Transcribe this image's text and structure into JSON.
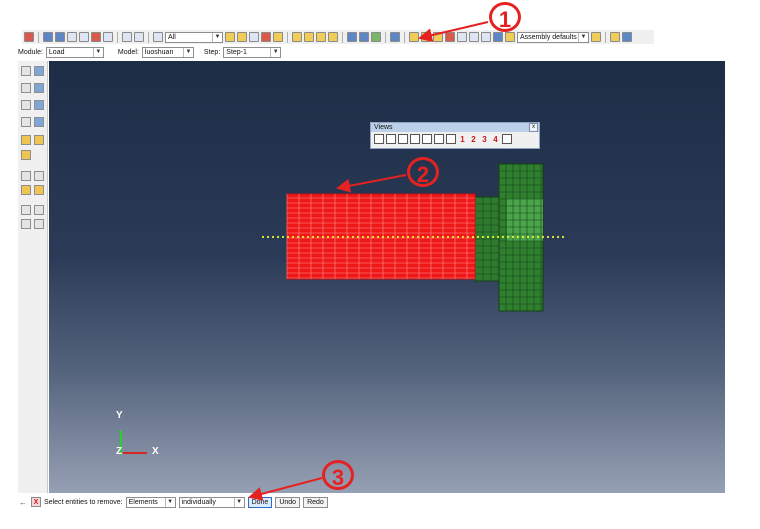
{
  "toolbar": {
    "select_filter": "All",
    "assembly_display": "Assembly defaults"
  },
  "context": {
    "module_label": "Module:",
    "module_value": "Load",
    "model_label": "Model:",
    "model_value": "luoshuan",
    "step_label": "Step:",
    "step_value": "Step-1"
  },
  "views": {
    "title": "Views",
    "close": "x",
    "numbers": [
      "1",
      "2",
      "3",
      "4"
    ]
  },
  "triad": {
    "y": "Y",
    "x": "X",
    "z": "Z"
  },
  "prompt": {
    "text": "Select entities to remove:",
    "entity_type": "Elements",
    "method": "individually",
    "done": "Done",
    "undo": "Undo",
    "redo": "Redo",
    "cancel": "X",
    "back": "←"
  },
  "callouts": {
    "c1": "1",
    "c2": "2",
    "c3": "3"
  },
  "colors": {
    "callout": "#e52222",
    "selected_elements": "#ef1818",
    "mesh_green": "#2f7f2f",
    "axis_dots": "#e7ef36"
  }
}
